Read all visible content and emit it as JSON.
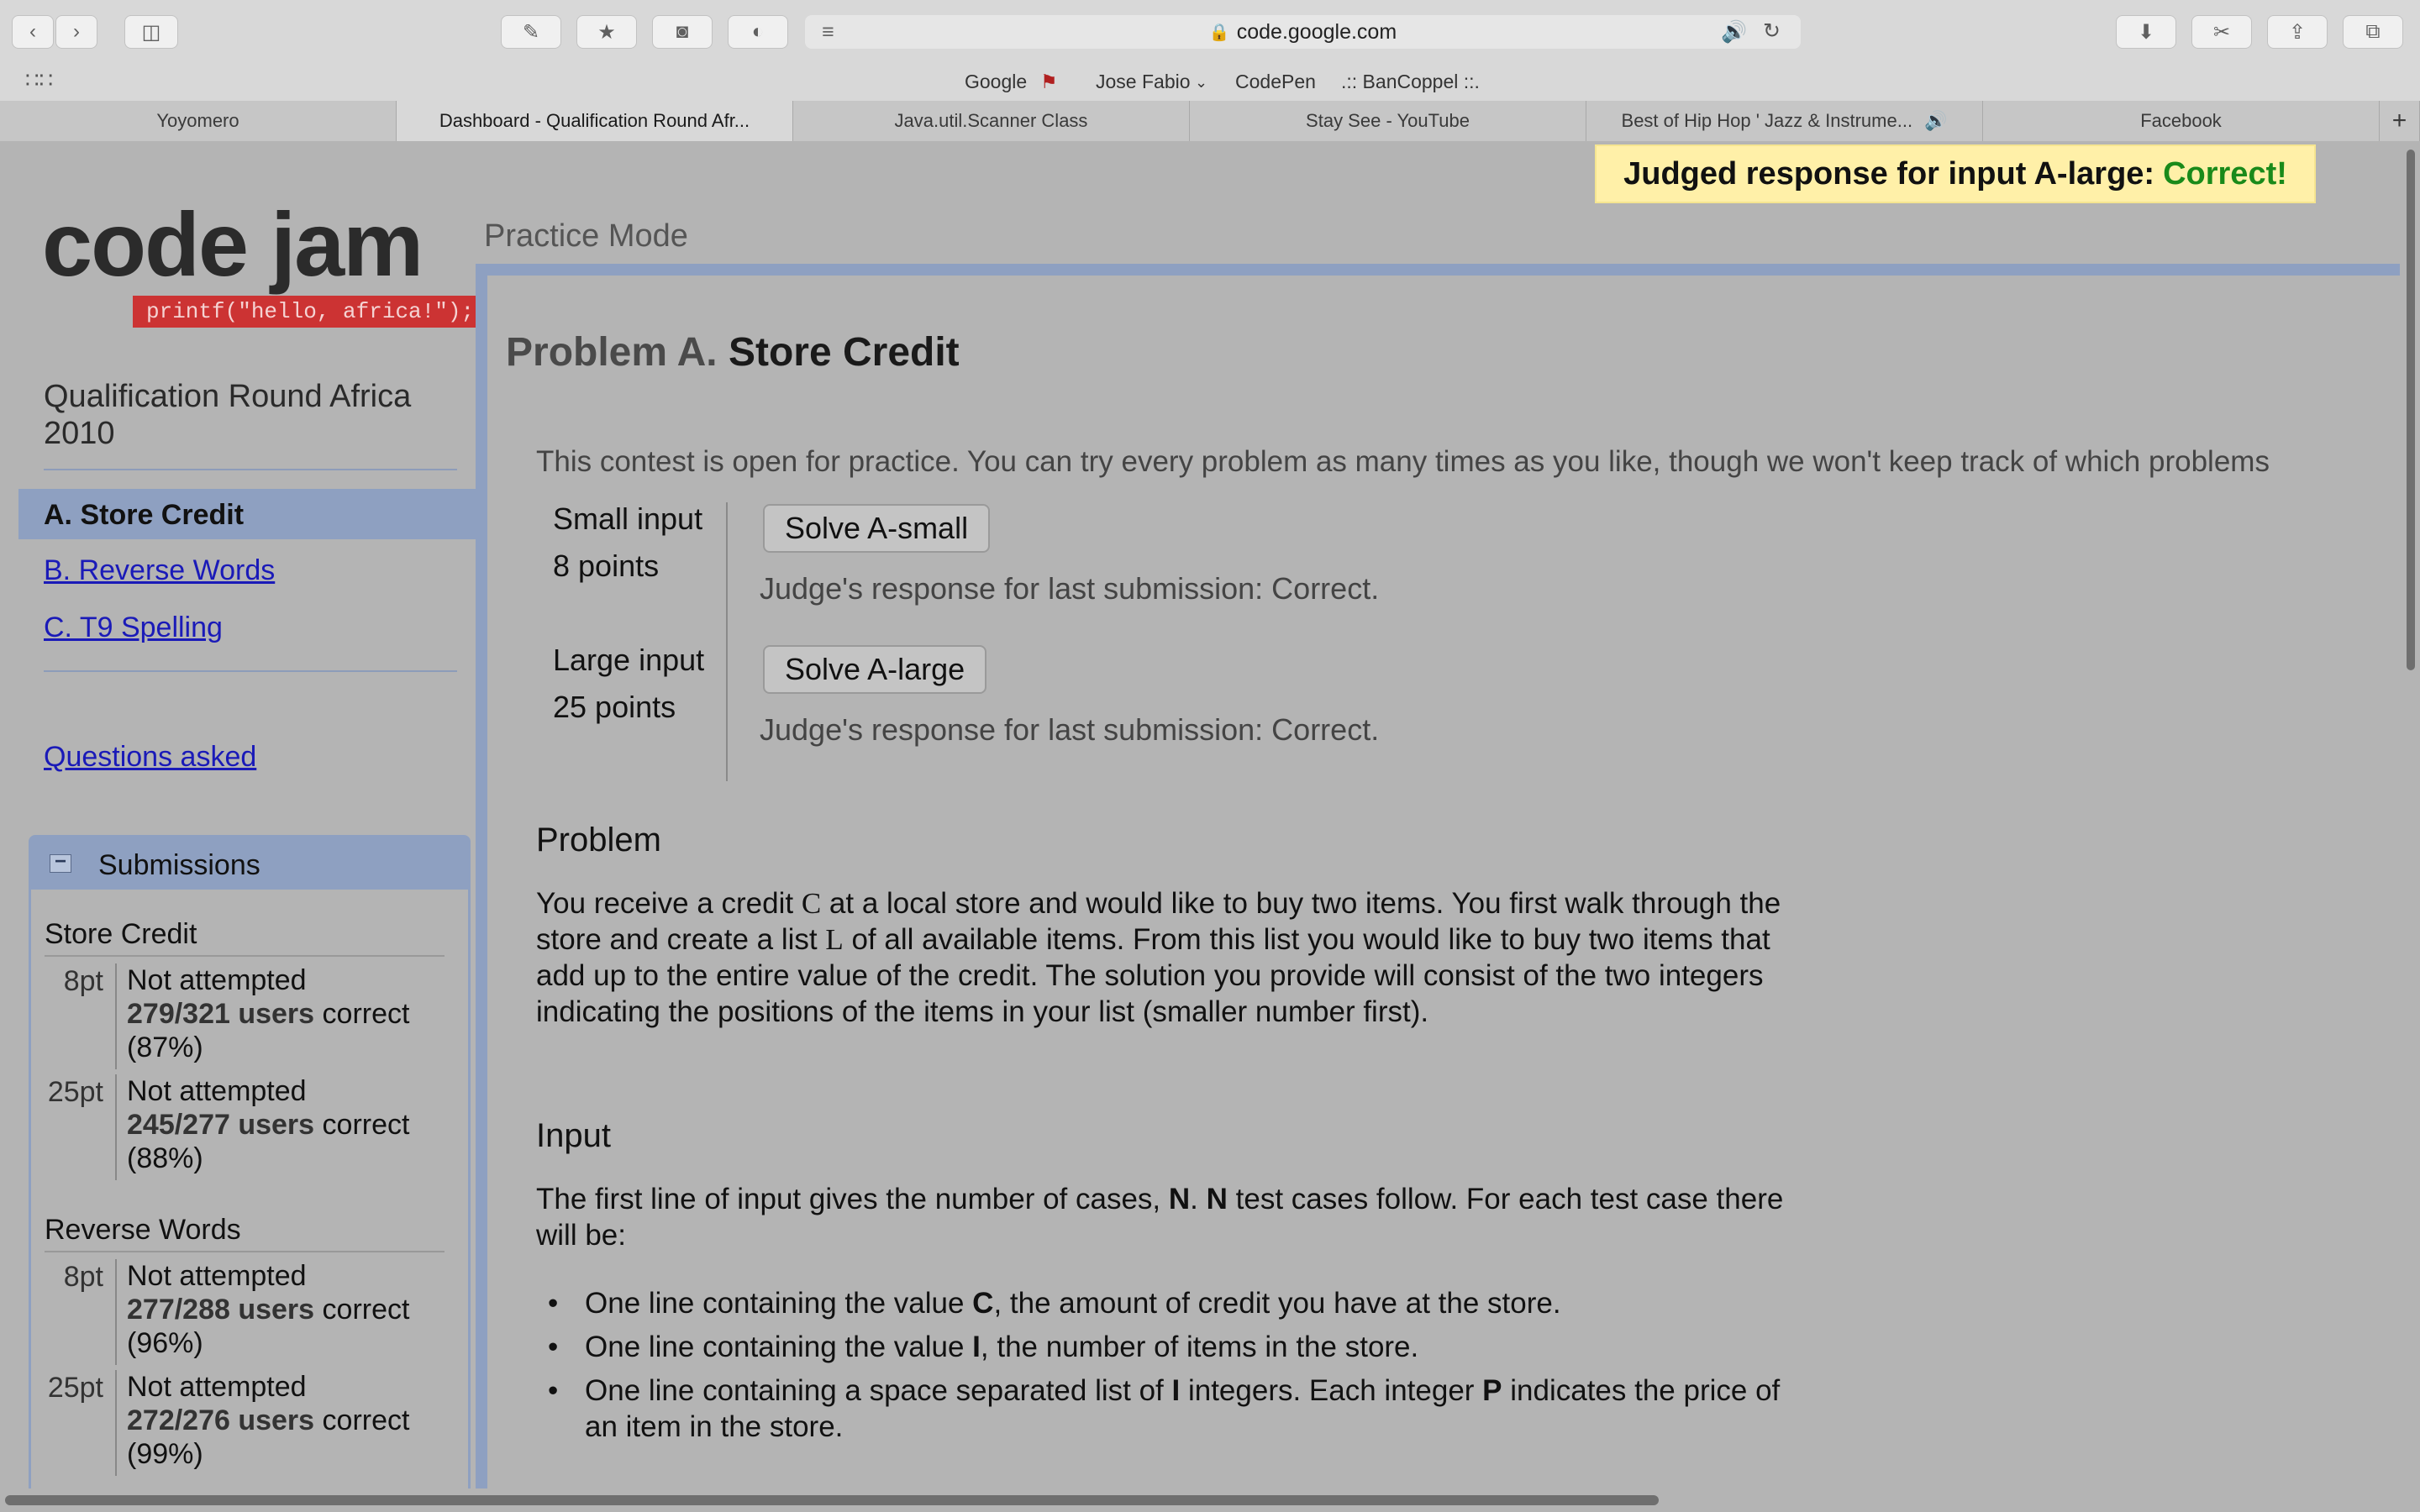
{
  "browser": {
    "url": "code.google.com",
    "favorites": [
      {
        "label": "Google"
      },
      {
        "label": "Jose Fabio"
      },
      {
        "label": "CodePen"
      },
      {
        "label": ".:: BanCoppel ::."
      }
    ],
    "tabs": [
      {
        "label": "Yoyomero"
      },
      {
        "label": "Dashboard - Qualification Round Afr..."
      },
      {
        "label": "Java.util.Scanner Class"
      },
      {
        "label": "Stay See - YouTube"
      },
      {
        "label": "Best of Hip Hop ' Jazz & Instrume..."
      },
      {
        "label": "Facebook"
      }
    ]
  },
  "toast": {
    "prefix": "Judged response for input A-large:",
    "result": "Correct!"
  },
  "sidebar": {
    "logo": "code jam",
    "tagline": "printf(\"hello, africa!\");",
    "round_title": "Qualification Round Africa 2010",
    "problems": [
      {
        "label": "A. Store Credit"
      },
      {
        "label": "B. Reverse Words"
      },
      {
        "label": "C. T9 Spelling"
      }
    ],
    "questions_link": "Questions asked",
    "submissions": {
      "title": "Submissions",
      "minus": "−",
      "sections": [
        {
          "name": "Store Credit",
          "rows": [
            {
              "pts": "8pt",
              "status": "Not attempted",
              "users": "279/321 users",
              "suffix": "correct",
              "pct": "(87%)"
            },
            {
              "pts": "25pt",
              "status": "Not attempted",
              "users": "245/277 users",
              "suffix": "correct",
              "pct": "(88%)"
            }
          ]
        },
        {
          "name": "Reverse Words",
          "rows": [
            {
              "pts": "8pt",
              "status": "Not attempted",
              "users": "277/288 users",
              "suffix": "correct",
              "pct": "(96%)"
            },
            {
              "pts": "25pt",
              "status": "Not attempted",
              "users": "272/276 users",
              "suffix": "correct",
              "pct": "(99%)"
            }
          ]
        }
      ]
    }
  },
  "main": {
    "mode": "Practice Mode",
    "problem_prefix": "Problem A.",
    "problem_name": "Store Credit",
    "practice_note": "This contest is open for practice. You can try every problem as many times as you like, though we won't keep track of which problems",
    "inputs": [
      {
        "label": "Small input",
        "points": "8 points",
        "button": "Solve A-small",
        "response": "Judge's response for last submission: Correct."
      },
      {
        "label": "Large input",
        "points": "25 points",
        "button": "Solve A-large",
        "response": "Judge's response for last submission: Correct."
      }
    ],
    "problem_heading": "Problem",
    "problem_text": {
      "p1": "You receive a credit ",
      "c": "C",
      "p2": " at a local store and would like to buy two items. You first walk through the store and create a list ",
      "l": "L",
      "p3": " of all available items. From this list you would like to buy two items that add up to the entire value of the credit. The solution you provide will consist of the two integers indicating the positions of the items in your list (smaller number first)."
    },
    "input_heading": "Input",
    "input_text": {
      "p1": "The first line of input gives the number of cases, ",
      "n1": "N",
      "p2": ". ",
      "n2": "N",
      "p3": " test cases follow. For each test case there will be:"
    },
    "bullets": [
      {
        "pre": "One line containing the value ",
        "b": "C",
        "post": ", the amount of credit you have at the store."
      },
      {
        "pre": "One line containing the value ",
        "b": "I",
        "post": ", the number of items in the store."
      },
      {
        "pre": "One line containing a space separated list of ",
        "b": "I",
        "mid": " integers. Each integer ",
        "b2": "P",
        "post": " indicates the price of an item in the store."
      }
    ]
  }
}
